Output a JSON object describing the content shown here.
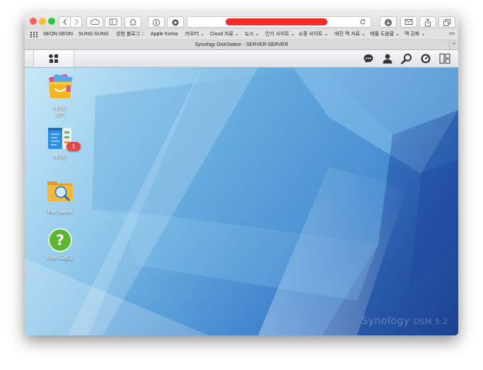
{
  "browser": {
    "bookmarks": [
      "SEON-SEON",
      "SUNG-SUNG",
      "성현 블로그 ::",
      "Apple Korea",
      "라우터 ⌄",
      "Cloud 자료 ⌄",
      "뉴스 ⌄",
      "인기 사이트 ⌄",
      "쇼핑 사이트 ⌄",
      "애진 맥 자료 ⌄",
      "애플 도움말 ⌄",
      "맥 강좌 ⌄"
    ],
    "more": ">>",
    "tab_title": "Synology DiskStation - SERVER-SERVER",
    "new_tab": "+"
  },
  "desktop": {
    "icons": [
      {
        "label_line1": "패키지",
        "label_line2": "센터",
        "icon": "package-center-icon"
      },
      {
        "label_line1": "제어판",
        "icon": "control-panel-icon",
        "badge": "1"
      },
      {
        "label_line1": "File Station",
        "icon": "file-station-icon"
      },
      {
        "label_line1": "DSM 도움말",
        "icon": "help-icon",
        "glyph": "?"
      }
    ],
    "brand": "Synology",
    "version": "DSM 5.2"
  },
  "colors": {
    "close": "#fc5f57",
    "minimize": "#fdbc2e",
    "maximize": "#28c840",
    "address_redaction": "#f32b2b",
    "badge": "#e64646"
  }
}
